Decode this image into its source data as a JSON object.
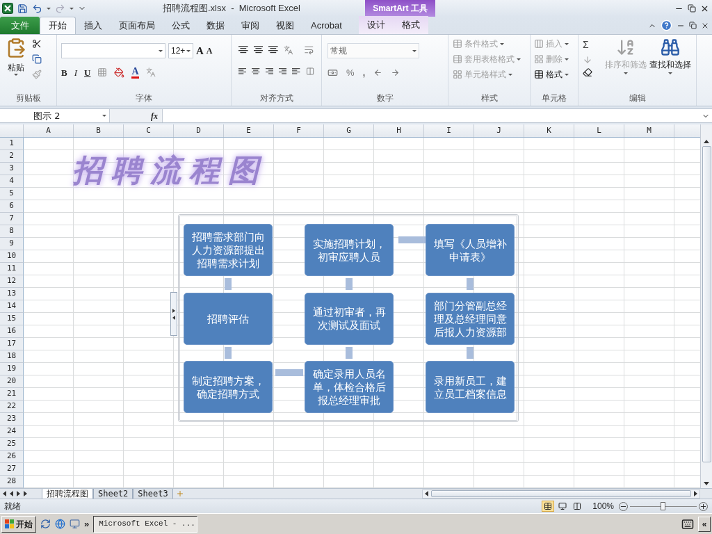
{
  "title_bar": {
    "title": "招聘流程图.xlsx  -  Microsoft Excel",
    "contextual_group": "SmartArt 工具"
  },
  "tabs": [
    {
      "label": "文件",
      "kind": "file",
      "selected": false
    },
    {
      "label": "开始",
      "kind": "normal",
      "selected": true
    },
    {
      "label": "插入",
      "kind": "normal",
      "selected": false
    },
    {
      "label": "页面布局",
      "kind": "normal",
      "selected": false
    },
    {
      "label": "公式",
      "kind": "normal",
      "selected": false
    },
    {
      "label": "数据",
      "kind": "normal",
      "selected": false
    },
    {
      "label": "审阅",
      "kind": "normal",
      "selected": false
    },
    {
      "label": "视图",
      "kind": "normal",
      "selected": false
    },
    {
      "label": "Acrobat",
      "kind": "normal",
      "selected": false
    },
    {
      "label": "设计",
      "kind": "contextual",
      "selected": false
    },
    {
      "label": "格式",
      "kind": "contextual",
      "selected": false
    }
  ],
  "ribbon": {
    "clipboard": {
      "paste": "粘贴",
      "group": "剪贴板"
    },
    "font": {
      "size": "12+",
      "grow": "A",
      "shrink": "A",
      "bold": "B",
      "italic": "I",
      "underline": "U",
      "color_letter": "A",
      "group": "字体"
    },
    "alignment": {
      "group": "对齐方式"
    },
    "number": {
      "format": "常规",
      "percent": "%",
      "comma": ",",
      "group": "数字"
    },
    "styles": {
      "items": [
        {
          "label": "条件格式",
          "disabled": true
        },
        {
          "label": "套用表格格式",
          "disabled": true
        },
        {
          "label": "单元格样式",
          "disabled": true
        }
      ],
      "group": "样式"
    },
    "cells": {
      "items": [
        {
          "label": "插入",
          "disabled": true
        },
        {
          "label": "删除",
          "disabled": true
        },
        {
          "label": "格式",
          "disabled": false
        }
      ],
      "group": "单元格"
    },
    "editing": {
      "sum": "Σ",
      "sort": {
        "label": "排序和筛选",
        "disabled": true
      },
      "find": {
        "label": "查找和选择",
        "disabled": false
      },
      "group": "编辑"
    }
  },
  "formula_bar": {
    "name_box": "图示 2",
    "fx": "fx"
  },
  "columns": [
    "A",
    "B",
    "C",
    "D",
    "E",
    "F",
    "G",
    "H",
    "I",
    "J",
    "K",
    "L",
    "M"
  ],
  "rows": [
    "1",
    "2",
    "3",
    "4",
    "5",
    "6",
    "7",
    "8",
    "9",
    "10",
    "11",
    "12",
    "13",
    "14",
    "15",
    "16",
    "17",
    "18",
    "19",
    "20",
    "21",
    "22",
    "23",
    "24",
    "25",
    "26",
    "27",
    "28"
  ],
  "wordart": "招聘流程图",
  "smartart": {
    "nodes": [
      "招聘需求部门向人力资源部提出招聘需求计划",
      "实施招聘计划，初审应聘人员",
      "填写《人员增补申请表》",
      "招聘评估",
      "通过初审者，再次测试及面试",
      "部门分管副总经理及总经理同意后报人力资源部",
      "制定招聘方案，确定招聘方式",
      "确定录用人员名单，体检合格后报总经理审批",
      "录用新员工，建立员工档案信息"
    ]
  },
  "sheet_tabs": [
    {
      "label": "招聘流程图",
      "selected": true
    },
    {
      "label": "Sheet2",
      "selected": false
    },
    {
      "label": "Sheet3",
      "selected": false
    }
  ],
  "status_bar": {
    "status": "就绪",
    "views": [
      {
        "selected": true
      },
      {
        "selected": false
      },
      {
        "selected": false
      }
    ],
    "zoom": "100%",
    "zoom_slider": {
      "level": 0.5
    }
  },
  "taskbar": {
    "start": "开始",
    "more": "»",
    "window": "Microsoft Excel - ...",
    "tray_toggle": "«"
  }
}
